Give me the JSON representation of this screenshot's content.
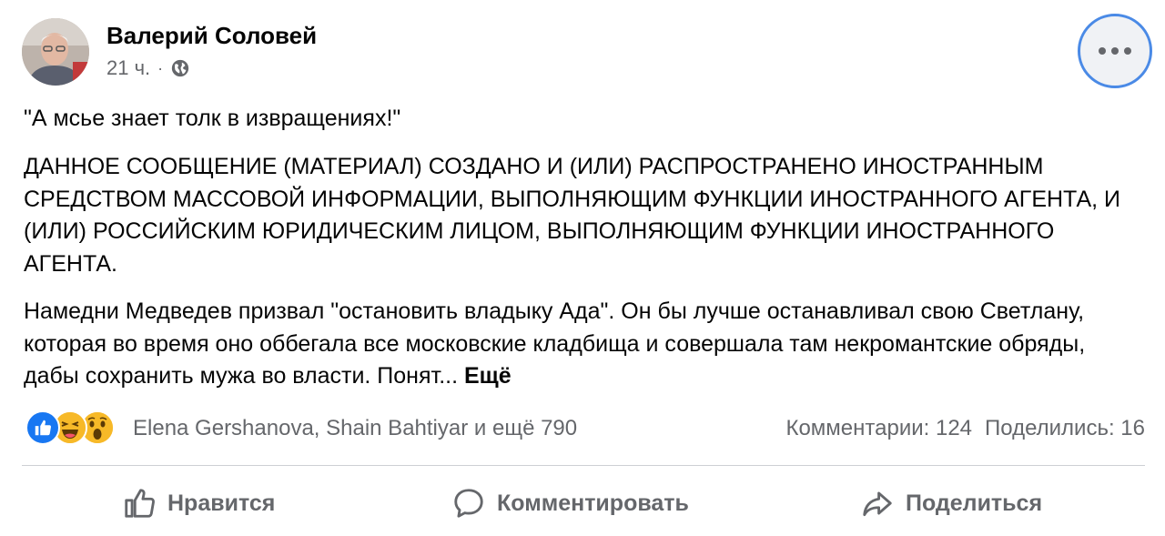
{
  "post": {
    "author": "Валерий Соловей",
    "time": "21 ч.",
    "separator": "·",
    "privacy_icon": "globe-icon",
    "paragraphs": {
      "p1": "\"А мсье знает толк в извращениях!\"",
      "p2": "ДАННОЕ СООБЩЕНИЕ (МАТЕРИАЛ) СОЗДАНО И (ИЛИ) РАСПРОСТРАНЕНО ИНОСТРАННЫМ СРЕДСТВОМ МАССОВОЙ ИНФОРМАЦИИ, ВЫПОЛНЯЮЩИМ ФУНКЦИИ ИНОСТРАННОГО АГЕНТА, И (ИЛИ) РОССИЙСКИМ ЮРИДИЧЕСКИМ ЛИЦОМ, ВЫПОЛНЯЮЩИМ ФУНКЦИИ ИНОСТРАННОГО АГЕНТА.",
      "p3": "Намедни  Медведев призвал \"остановить владыку Ада\". Он бы лучше останавливал свою Светлану, которая во время оно оббегала все московские кладбища и совершала там некромантские обряды, дабы сохранить мужа во  власти. Понят...",
      "see_more": "Ещё"
    },
    "reactions": {
      "icons": [
        "like-icon",
        "haha-icon",
        "wow-icon"
      ],
      "names": "Elena Gershanova, Shain Bahtiyar и ещё 790",
      "comments": "Комментарии: 124",
      "shares": "Поделились: 16"
    },
    "actions": {
      "like": "Нравится",
      "comment": "Комментировать",
      "share": "Поделиться"
    },
    "colors": {
      "accent": "#1877f2",
      "secondary_text": "#65676b",
      "focus_ring": "#4a8ae6"
    }
  }
}
